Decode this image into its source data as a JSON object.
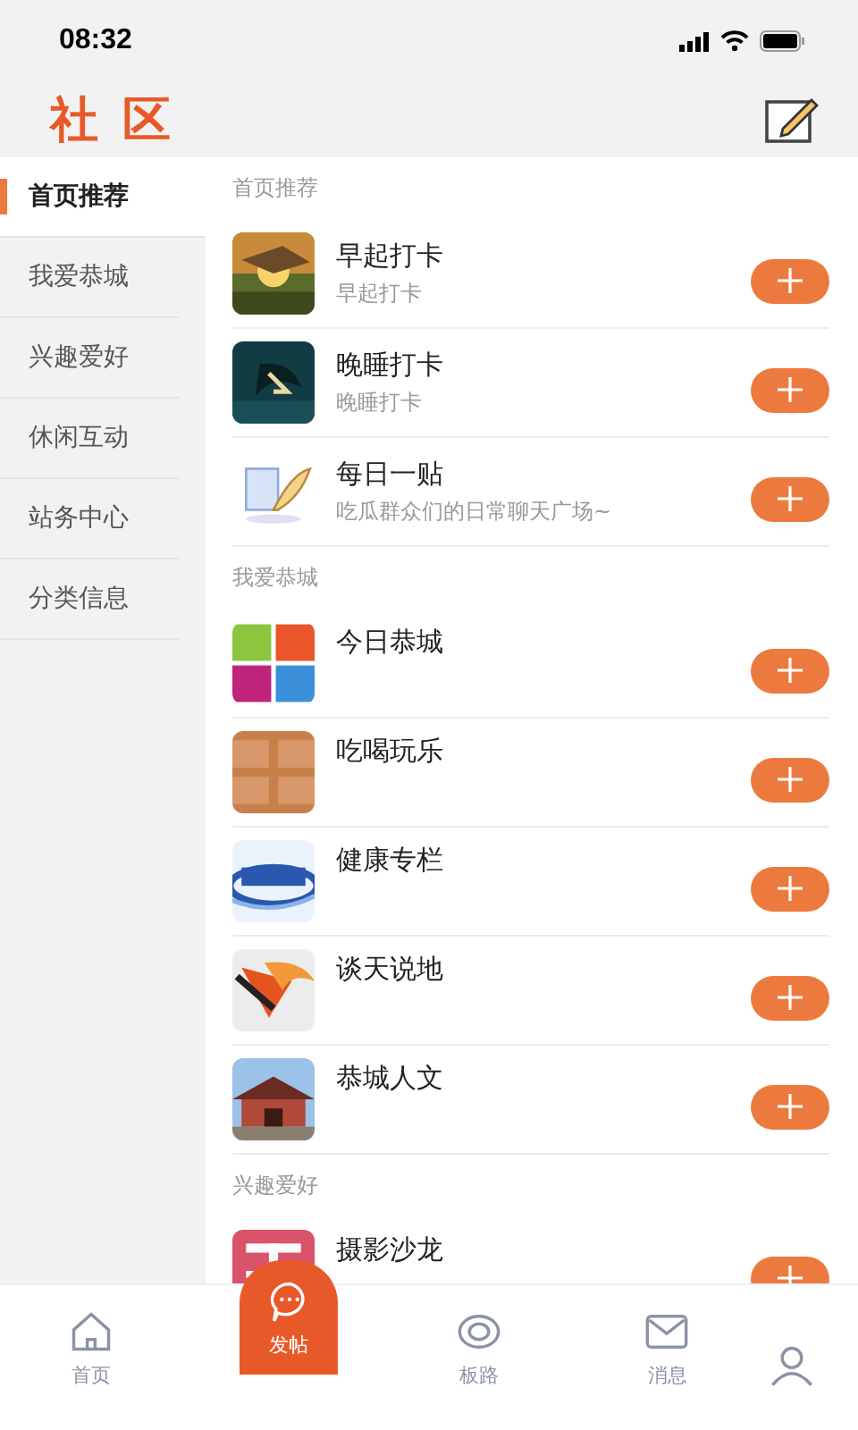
{
  "status_bar": {
    "time": "08:32"
  },
  "header": {
    "title": "社 区"
  },
  "sidebar": {
    "items": [
      {
        "label": "首页推荐",
        "selected": true
      },
      {
        "label": "我爱恭城",
        "selected": false
      },
      {
        "label": "兴趣爱好",
        "selected": false
      },
      {
        "label": "休闲互动",
        "selected": false
      },
      {
        "label": "站务中心",
        "selected": false
      },
      {
        "label": "分类信息",
        "selected": false
      }
    ]
  },
  "sections": [
    {
      "title": "首页推荐",
      "items": [
        {
          "name": "早起打卡",
          "subtitle": "早起打卡"
        },
        {
          "name": "晚睡打卡",
          "subtitle": "晚睡打卡"
        },
        {
          "name": "每日一贴",
          "subtitle": "吃瓜群众们的日常聊天广场~"
        }
      ]
    },
    {
      "title": "我爱恭城",
      "items": [
        {
          "name": "今日恭城"
        },
        {
          "name": "吃喝玩乐"
        },
        {
          "name": "健康专栏"
        },
        {
          "name": "谈天说地"
        },
        {
          "name": "恭城人文"
        }
      ]
    },
    {
      "title": "兴趣爱好",
      "items": [
        {
          "name": "摄影沙龙"
        }
      ]
    }
  ],
  "bottom_nav": [
    {
      "kind": "home",
      "label": "首页"
    },
    {
      "kind": "post",
      "label": "发帖"
    },
    {
      "kind": "boards",
      "label": "板路"
    },
    {
      "kind": "messages",
      "label": "消息"
    },
    {
      "kind": "profile"
    }
  ]
}
